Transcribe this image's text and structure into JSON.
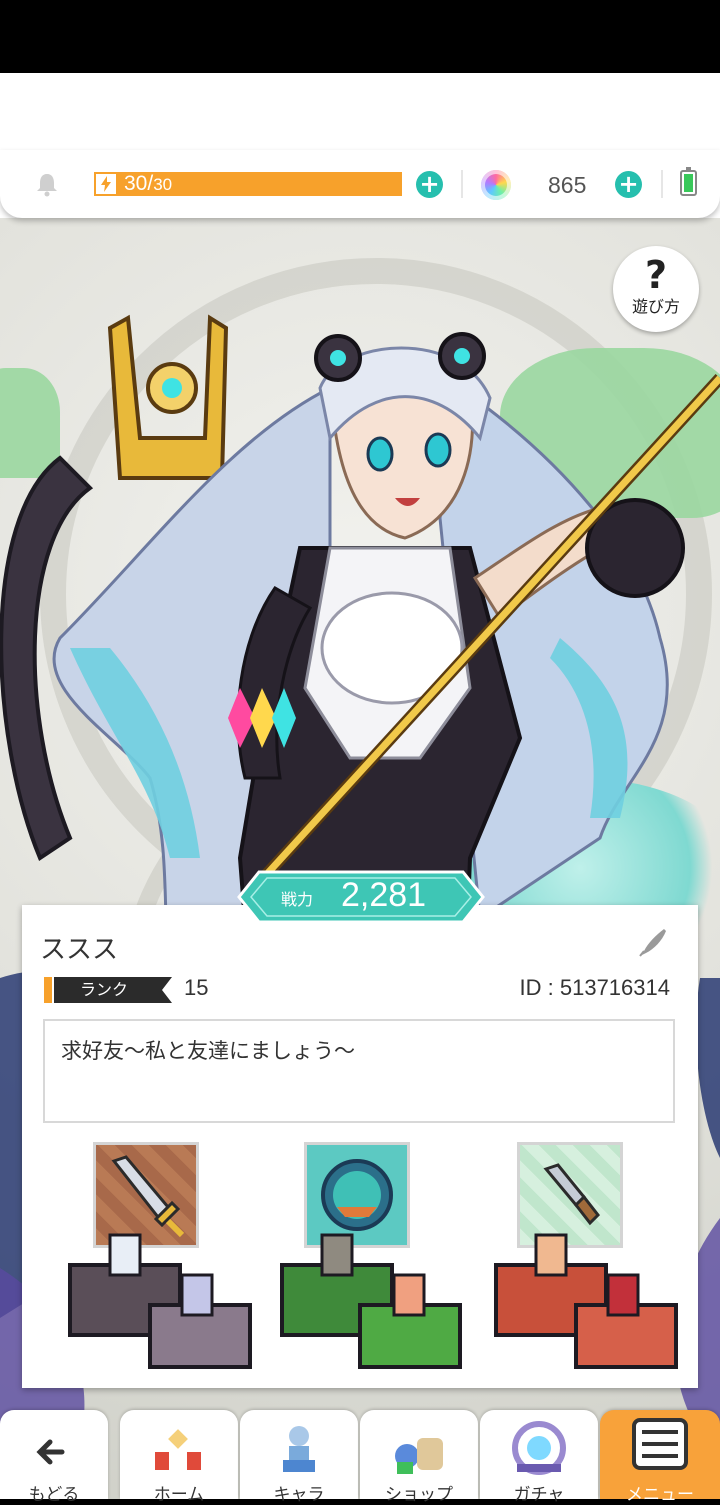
{
  "header": {
    "stamina_text": "30/",
    "stamina_max": "30",
    "stamina_fraction": 1.0,
    "gems": "865"
  },
  "help": {
    "label": "遊び方"
  },
  "profile": {
    "power_label": "戦力",
    "power_value": "2,281",
    "name": "ススス",
    "rank_label": "ランク",
    "rank_value": "15",
    "player_id": "ID : 513716314",
    "comment": "求好友〜私と友達にましょう〜"
  },
  "nav": {
    "items": [
      {
        "label": "もどる",
        "icon": "back-arrow-icon"
      },
      {
        "label": "ホーム",
        "icon": "home-icon"
      },
      {
        "label": "キャラ",
        "icon": "character-icon"
      },
      {
        "label": "ショップ",
        "icon": "shop-icon"
      },
      {
        "label": "ガチャ",
        "icon": "gacha-icon"
      },
      {
        "label": "メニュー",
        "icon": "menu-icon"
      }
    ]
  },
  "colors": {
    "accent": "#26bfae",
    "stamina": "#f7a12b",
    "menu_active": "#f8a23a",
    "badge": "#3ec6b5"
  }
}
